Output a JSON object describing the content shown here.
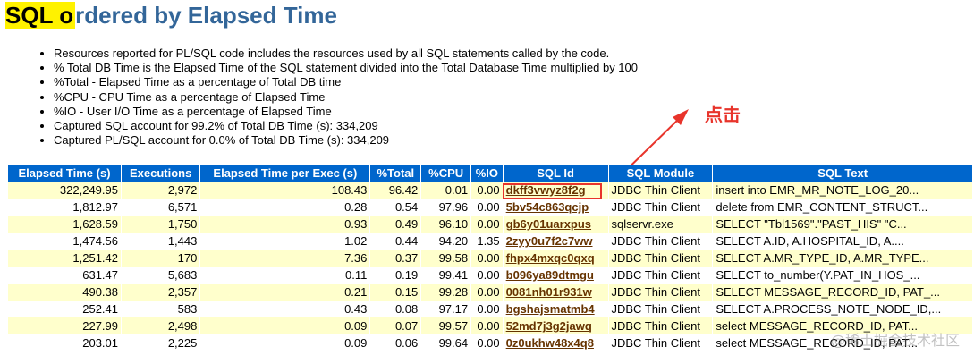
{
  "title": {
    "highlight": "SQL o",
    "rest": "rdered by Elapsed Time"
  },
  "bullets": [
    "Resources reported for PL/SQL code includes the resources used by all SQL statements called by the code.",
    "% Total DB Time is the Elapsed Time of the SQL statement divided into the Total Database Time multiplied by 100",
    "%Total - Elapsed Time as a percentage of Total DB time",
    "%CPU - CPU Time as a percentage of Elapsed Time",
    "%IO - User I/O Time as a percentage of Elapsed Time",
    "Captured SQL account for 99.2% of Total DB Time (s): 334,209",
    "Captured PL/SQL account for 0.0% of Total DB Time (s): 334,209"
  ],
  "annotation": "点击",
  "table": {
    "headers": [
      "Elapsed Time (s)",
      "Executions",
      "Elapsed Time per Exec (s)",
      "%Total",
      "%CPU",
      "%IO",
      "SQL Id",
      "SQL Module",
      "SQL Text"
    ],
    "rows": [
      [
        "322,249.95",
        "2,972",
        "108.43",
        "96.42",
        "0.01",
        "0.00",
        "dkff3vwyz8f2g",
        "JDBC Thin Client",
        "insert into EMR_MR_NOTE_LOG_20..."
      ],
      [
        "1,812.97",
        "6,571",
        "0.28",
        "0.54",
        "97.96",
        "0.00",
        "5bv54c863qcjp",
        "JDBC Thin Client",
        "delete from EMR_CONTENT_STRUCT..."
      ],
      [
        "1,628.59",
        "1,750",
        "0.93",
        "0.49",
        "96.10",
        "0.00",
        "gb6y01uarxpus",
        "sqlservr.exe",
        "SELECT \"Tbl1569\".\"PAST_HIS\" \"C..."
      ],
      [
        "1,474.56",
        "1,443",
        "1.02",
        "0.44",
        "94.20",
        "1.35",
        "2zyy0u7f2c7ww",
        "JDBC Thin Client",
        "SELECT A.ID, A.HOSPITAL_ID, A...."
      ],
      [
        "1,251.42",
        "170",
        "7.36",
        "0.37",
        "99.58",
        "0.00",
        "fhpx4mxqc0qxq",
        "JDBC Thin Client",
        "SELECT A.MR_TYPE_ID, A.MR_TYPE..."
      ],
      [
        "631.47",
        "5,683",
        "0.11",
        "0.19",
        "99.41",
        "0.00",
        "b096ya89dtmgu",
        "JDBC Thin Client",
        "SELECT to_number(Y.PAT_IN_HOS_..."
      ],
      [
        "490.38",
        "2,357",
        "0.21",
        "0.15",
        "99.28",
        "0.00",
        "0081nh01r931w",
        "JDBC Thin Client",
        "SELECT MESSAGE_RECORD_ID, PAT_..."
      ],
      [
        "252.41",
        "583",
        "0.43",
        "0.08",
        "97.17",
        "0.00",
        "bgshajsmatmb4",
        "JDBC Thin Client",
        "SELECT A.PROCESS_NOTE_NODE_ID,..."
      ],
      [
        "227.99",
        "2,498",
        "0.09",
        "0.07",
        "99.57",
        "0.00",
        "52md7j3g2jawq",
        "JDBC Thin Client",
        "select MESSAGE_RECORD_ID, PAT..."
      ],
      [
        "203.01",
        "2,225",
        "0.09",
        "0.06",
        "99.64",
        "0.00",
        "0z0ukhw48x4q8",
        "JDBC Thin Client",
        "select MESSAGE_RECORD_ID, PAT..."
      ]
    ]
  },
  "watermark": "@稀土掘金技术社区",
  "colors": {
    "header_bg": "#0066cc",
    "row_highlight": "#ffffcc",
    "title": "#336699",
    "annotation": "#e8342b"
  }
}
